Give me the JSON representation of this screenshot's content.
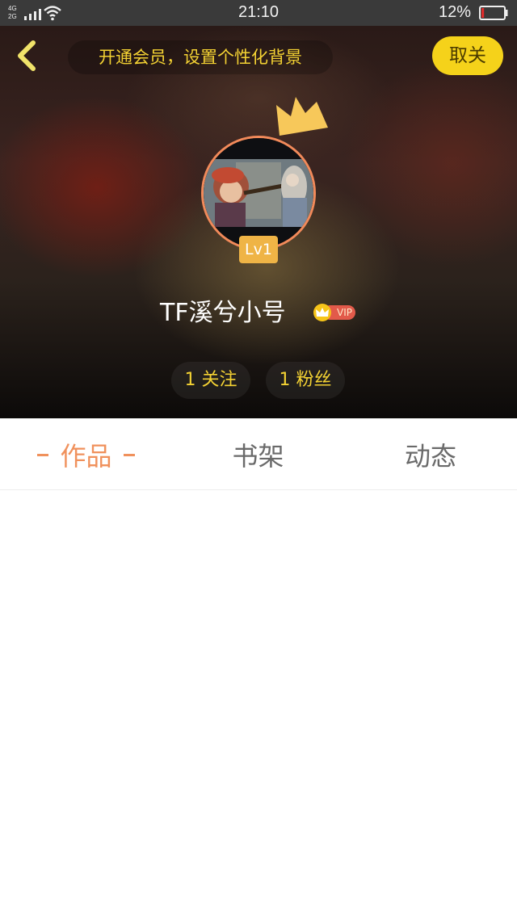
{
  "status_bar": {
    "network_top": "4G",
    "network_bottom": "2G",
    "time": "21:10",
    "battery_percent": "12%",
    "battery_level": 0.12,
    "battery_color": "#e02b2b"
  },
  "header": {
    "back_icon": "chevron-left-icon",
    "promo_text": "开通会员，设置个性化背景",
    "cancel_label": "取关",
    "accent_color": "#f5d21a",
    "level": "Lv1",
    "username": "TF溪兮小号",
    "vip_label": "VIP",
    "stats": {
      "follow": "1 关注",
      "fans": "1 粉丝"
    }
  },
  "tabs": {
    "items": [
      {
        "label": "作品",
        "active": true
      },
      {
        "label": "书架",
        "active": false
      },
      {
        "label": "动态",
        "active": false
      }
    ],
    "active_color": "#f0915c"
  }
}
